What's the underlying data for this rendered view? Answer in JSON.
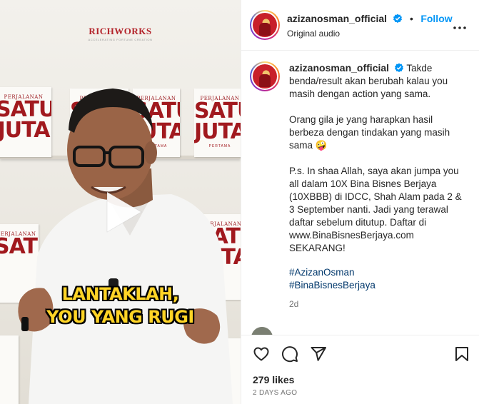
{
  "media": {
    "brand": {
      "name": "RICHWORKS",
      "tagline": "ACCELERATING FORTUNE CREATION"
    },
    "books": {
      "eyebrow": "PERJALANAN",
      "title_line1": "SATU",
      "title_line2": "JUTA",
      "foot": "PERTAMA"
    },
    "caption_line1": "LANTAKLAH,",
    "caption_line2": "YOU YANG RUGI"
  },
  "header": {
    "username": "azizanosman_official",
    "separator": "•",
    "follow_label": "Follow",
    "audio_label": "Original audio"
  },
  "caption": {
    "username": "azizanosman_official",
    "paragraph1": "Takde benda/result akan berubah kalau you masih dengan action yang sama.",
    "paragraph2": "Orang gila je yang harapkan hasil berbeza dengan tindakan yang masih sama 🤪",
    "paragraph3": "P.s. In shaa Allah, saya akan jumpa you all dalam 10X Bina Bisnes Berjaya (10XBBB) di IDCC, Shah Alam pada 2 & 3 September nanti. Jadi yang terawal daftar sebelum ditutup. Daftar di www.BinaBisnesBerjaya.com SEKARANG!",
    "hashtags": [
      "#AzizanOsman",
      "#BinaBisnesBerjaya"
    ],
    "timestamp": "2d"
  },
  "actions": {
    "like_icon": "heart-icon",
    "comment_icon": "comment-icon",
    "share_icon": "share-icon",
    "save_icon": "bookmark-icon",
    "likes_count": "279 likes",
    "date": "2 DAYS AGO"
  },
  "colors": {
    "follow_blue": "#0095f6",
    "hashtag_blue": "#00376b",
    "verified_blue": "#0095f6",
    "caption_yellow": "#ffd426",
    "brand_red": "#b3232a"
  }
}
